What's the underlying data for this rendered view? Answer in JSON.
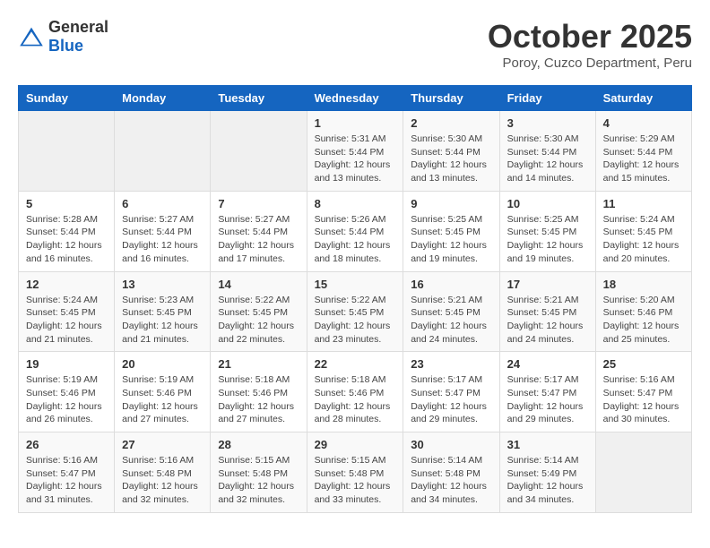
{
  "header": {
    "logo": {
      "general": "General",
      "blue": "Blue"
    },
    "title": "October 2025",
    "subtitle": "Poroy, Cuzco Department, Peru"
  },
  "weekdays": [
    "Sunday",
    "Monday",
    "Tuesday",
    "Wednesday",
    "Thursday",
    "Friday",
    "Saturday"
  ],
  "weeks": [
    [
      {
        "day": "",
        "info": ""
      },
      {
        "day": "",
        "info": ""
      },
      {
        "day": "",
        "info": ""
      },
      {
        "day": "1",
        "info": "Sunrise: 5:31 AM\nSunset: 5:44 PM\nDaylight: 12 hours and 13 minutes."
      },
      {
        "day": "2",
        "info": "Sunrise: 5:30 AM\nSunset: 5:44 PM\nDaylight: 12 hours and 13 minutes."
      },
      {
        "day": "3",
        "info": "Sunrise: 5:30 AM\nSunset: 5:44 PM\nDaylight: 12 hours and 14 minutes."
      },
      {
        "day": "4",
        "info": "Sunrise: 5:29 AM\nSunset: 5:44 PM\nDaylight: 12 hours and 15 minutes."
      }
    ],
    [
      {
        "day": "5",
        "info": "Sunrise: 5:28 AM\nSunset: 5:44 PM\nDaylight: 12 hours and 16 minutes."
      },
      {
        "day": "6",
        "info": "Sunrise: 5:27 AM\nSunset: 5:44 PM\nDaylight: 12 hours and 16 minutes."
      },
      {
        "day": "7",
        "info": "Sunrise: 5:27 AM\nSunset: 5:44 PM\nDaylight: 12 hours and 17 minutes."
      },
      {
        "day": "8",
        "info": "Sunrise: 5:26 AM\nSunset: 5:44 PM\nDaylight: 12 hours and 18 minutes."
      },
      {
        "day": "9",
        "info": "Sunrise: 5:25 AM\nSunset: 5:45 PM\nDaylight: 12 hours and 19 minutes."
      },
      {
        "day": "10",
        "info": "Sunrise: 5:25 AM\nSunset: 5:45 PM\nDaylight: 12 hours and 19 minutes."
      },
      {
        "day": "11",
        "info": "Sunrise: 5:24 AM\nSunset: 5:45 PM\nDaylight: 12 hours and 20 minutes."
      }
    ],
    [
      {
        "day": "12",
        "info": "Sunrise: 5:24 AM\nSunset: 5:45 PM\nDaylight: 12 hours and 21 minutes."
      },
      {
        "day": "13",
        "info": "Sunrise: 5:23 AM\nSunset: 5:45 PM\nDaylight: 12 hours and 21 minutes."
      },
      {
        "day": "14",
        "info": "Sunrise: 5:22 AM\nSunset: 5:45 PM\nDaylight: 12 hours and 22 minutes."
      },
      {
        "day": "15",
        "info": "Sunrise: 5:22 AM\nSunset: 5:45 PM\nDaylight: 12 hours and 23 minutes."
      },
      {
        "day": "16",
        "info": "Sunrise: 5:21 AM\nSunset: 5:45 PM\nDaylight: 12 hours and 24 minutes."
      },
      {
        "day": "17",
        "info": "Sunrise: 5:21 AM\nSunset: 5:45 PM\nDaylight: 12 hours and 24 minutes."
      },
      {
        "day": "18",
        "info": "Sunrise: 5:20 AM\nSunset: 5:46 PM\nDaylight: 12 hours and 25 minutes."
      }
    ],
    [
      {
        "day": "19",
        "info": "Sunrise: 5:19 AM\nSunset: 5:46 PM\nDaylight: 12 hours and 26 minutes."
      },
      {
        "day": "20",
        "info": "Sunrise: 5:19 AM\nSunset: 5:46 PM\nDaylight: 12 hours and 27 minutes."
      },
      {
        "day": "21",
        "info": "Sunrise: 5:18 AM\nSunset: 5:46 PM\nDaylight: 12 hours and 27 minutes."
      },
      {
        "day": "22",
        "info": "Sunrise: 5:18 AM\nSunset: 5:46 PM\nDaylight: 12 hours and 28 minutes."
      },
      {
        "day": "23",
        "info": "Sunrise: 5:17 AM\nSunset: 5:47 PM\nDaylight: 12 hours and 29 minutes."
      },
      {
        "day": "24",
        "info": "Sunrise: 5:17 AM\nSunset: 5:47 PM\nDaylight: 12 hours and 29 minutes."
      },
      {
        "day": "25",
        "info": "Sunrise: 5:16 AM\nSunset: 5:47 PM\nDaylight: 12 hours and 30 minutes."
      }
    ],
    [
      {
        "day": "26",
        "info": "Sunrise: 5:16 AM\nSunset: 5:47 PM\nDaylight: 12 hours and 31 minutes."
      },
      {
        "day": "27",
        "info": "Sunrise: 5:16 AM\nSunset: 5:48 PM\nDaylight: 12 hours and 32 minutes."
      },
      {
        "day": "28",
        "info": "Sunrise: 5:15 AM\nSunset: 5:48 PM\nDaylight: 12 hours and 32 minutes."
      },
      {
        "day": "29",
        "info": "Sunrise: 5:15 AM\nSunset: 5:48 PM\nDaylight: 12 hours and 33 minutes."
      },
      {
        "day": "30",
        "info": "Sunrise: 5:14 AM\nSunset: 5:48 PM\nDaylight: 12 hours and 34 minutes."
      },
      {
        "day": "31",
        "info": "Sunrise: 5:14 AM\nSunset: 5:49 PM\nDaylight: 12 hours and 34 minutes."
      },
      {
        "day": "",
        "info": ""
      }
    ]
  ]
}
